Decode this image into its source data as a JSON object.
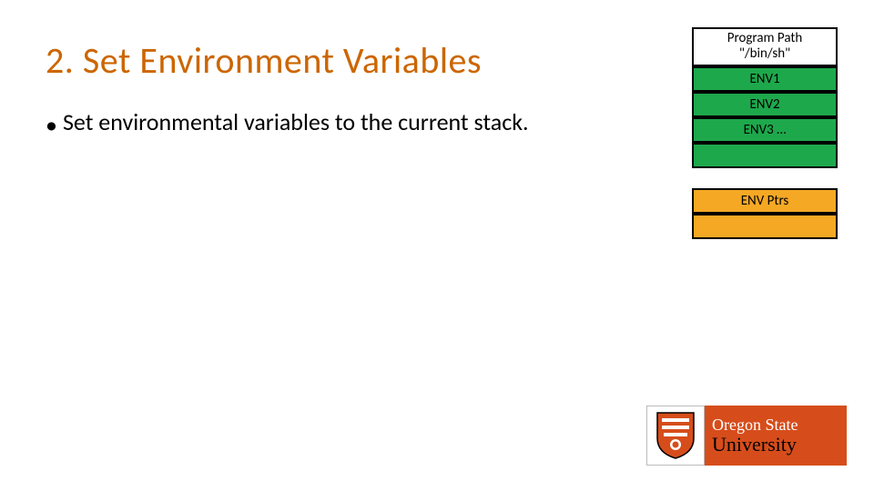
{
  "slide": {
    "title": "2. Set Environment Variables",
    "bullet": "Set environmental variables to the current stack."
  },
  "stack": {
    "program_path_label": "Program Path",
    "program_path_value": "\"/bin/sh\"",
    "env1": "ENV1",
    "env2": "ENV2",
    "env3": "ENV3 …",
    "env_ptrs": "ENV Ptrs"
  },
  "logo": {
    "line1": "Oregon State",
    "line2": "University"
  }
}
